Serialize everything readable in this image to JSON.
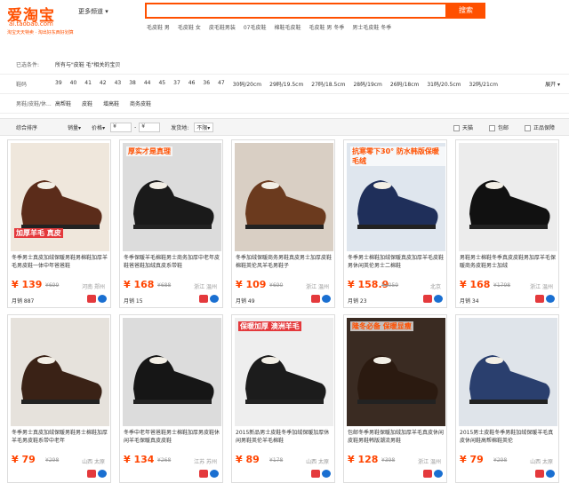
{
  "header": {
    "logo": "爱淘宝",
    "logo_url": "ai.taobao.com",
    "slogan": "淘宝天天特卖 · 淘出好东西好划算",
    "category_button": "更多频道",
    "search_button": "搜索",
    "hot_words": [
      "毛皮鞋 男",
      "毛皮鞋 女",
      "皮毛鞋男装",
      "07毛皮鞋",
      "棉鞋毛皮鞋",
      "毛皮鞋 男 冬季",
      "男士毛皮鞋 冬季"
    ]
  },
  "filters": {
    "selected_label": "已选条件:",
    "selected_value": "所有与\"皮鞋 毛\"相关的宝贝",
    "size_label": "鞋码",
    "sizes": [
      "39",
      "40",
      "41",
      "42",
      "43",
      "38",
      "44",
      "45",
      "37",
      "46",
      "36",
      "47",
      "30码/20cm",
      "29码/19.5cm",
      "27码/18.5cm",
      "28码/19cm",
      "26码/18cm",
      "31码/20.5cm",
      "32码/21cm"
    ],
    "expand": "展开",
    "style_label": "男鞋/皮鞋/休...",
    "styles": [
      "高帮鞋",
      "皮鞋",
      "增高鞋",
      "商务皮鞋"
    ]
  },
  "sortbar": {
    "sort": "综合排序",
    "sales": "销量",
    "price": "价格",
    "price_from": "¥",
    "price_to": "¥",
    "ship_label": "发货地:",
    "ship_value": "不限",
    "tmall": "天猫",
    "free_ship": "包邮",
    "genuine": "正品保障"
  },
  "cards": [
    {
      "title": "冬季男士真皮加绒保暖男鞋男棉鞋加厚羊毛男皮鞋一体中年爸爸鞋",
      "price": "139",
      "old": "699",
      "loc": "河南 郑州",
      "sales": "月销 887",
      "promo": "加厚羊毛 真皮"
    },
    {
      "title": "冬季保暖羊毛棉鞋男士商务加厚中老年皮鞋爸爸鞋加绒真皮系带鞋",
      "price": "168",
      "old": "688",
      "loc": "浙江 温州",
      "sales": "月销 15",
      "promo": "厚实才是真理"
    },
    {
      "title": "冬季加绒保暖商务男鞋真皮男士加厚皮鞋棉鞋英伦风羊毛男鞋子",
      "price": "109",
      "old": "690",
      "loc": "浙江 温州",
      "sales": "月销 49",
      "promo": ""
    },
    {
      "title": "冬季男士棉鞋加绒保暖真皮加厚羊毛皮鞋男休闲英伦男士二棉鞋",
      "price": "158.9",
      "old": "1059",
      "loc": "北京",
      "sales": "月销 23",
      "promo": "抗寒零下30° 防水韩版保暖毛绒"
    },
    {
      "title": "男鞋男士棉鞋冬季真皮皮鞋男加厚羊毛保暖商务皮鞋男士加绒",
      "price": "168",
      "old": "1798",
      "loc": "浙江 温州",
      "sales": "月销 34",
      "promo": ""
    },
    {
      "title": "冬季男士真皮加绒保暖男鞋男士棉鞋加厚羊毛男皮鞋系带中老年",
      "price": "79",
      "old": "298",
      "loc": "山西 太原",
      "sales": "",
      "promo": ""
    },
    {
      "title": "冬季中老年爸爸鞋男士棉鞋加厚男皮鞋休闲羊毛保暖真皮皮鞋",
      "price": "134",
      "old": "268",
      "loc": "江苏 苏州",
      "sales": "",
      "promo": ""
    },
    {
      "title": "2015新品男士皮鞋冬季加绒保暖加厚休闲男鞋英伦羊毛棉鞋",
      "price": "89",
      "old": "178",
      "loc": "山西 太原",
      "sales": "",
      "promo": "保暖加厚 澳洲羊毛"
    },
    {
      "title": "包邮冬季男鞋保暖加绒加厚羊毛真皮休闲皮鞋男鞋韩版潮流男鞋",
      "price": "128",
      "old": "398",
      "loc": "浙江 温州",
      "sales": "",
      "promo": "隆冬必备 保暖显瘦"
    },
    {
      "title": "2015男士皮鞋冬季男鞋加绒保暖羊毛真皮休闲鞋高帮棉鞋英伦",
      "price": "79",
      "old": "298",
      "loc": "山西 太原",
      "sales": "",
      "promo": ""
    }
  ]
}
